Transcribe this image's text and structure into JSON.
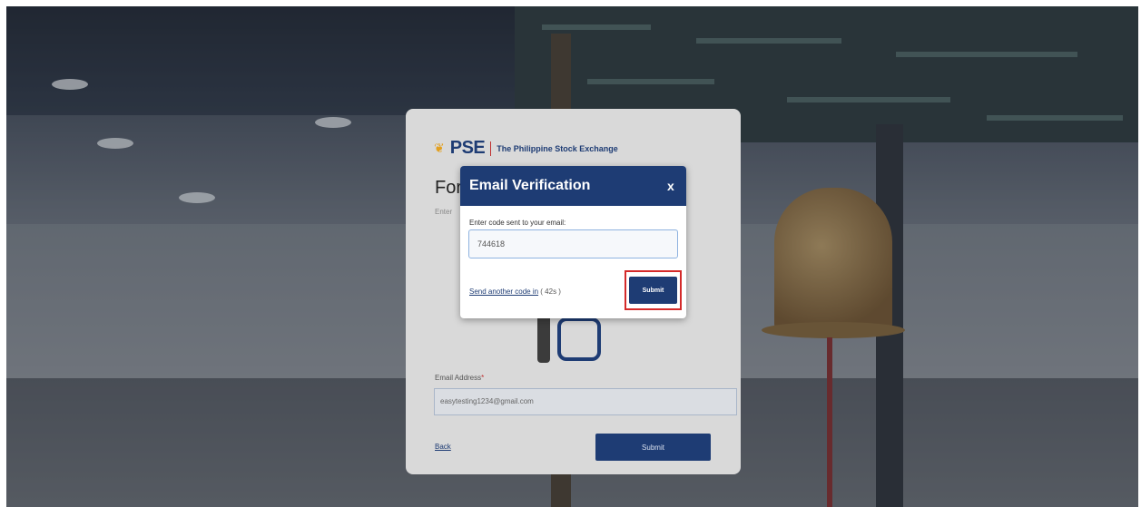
{
  "background_card": {
    "logo_mark": "PSE",
    "logo_name": "The Philippine Stock Exchange",
    "title": "For",
    "subtitle": "Enter",
    "email_label": "Email Address",
    "email_required_marker": "*",
    "email_value": "easytesting1234@gmail.com",
    "back_label": "Back",
    "submit_label": "Submit"
  },
  "modal": {
    "title": "Email Verification",
    "close_label": "x",
    "code_label": "Enter code sent to your email:",
    "code_value": "744618",
    "resend_label": "Send another code in",
    "resend_timer": "( 42s )",
    "submit_label": "Submit"
  },
  "colors": {
    "primary": "#1e3c74",
    "highlight": "#d42a2a"
  }
}
